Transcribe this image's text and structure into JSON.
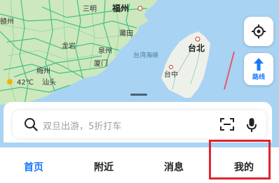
{
  "map": {
    "labels": {
      "ganzhou": "赣州",
      "sanming": "三明",
      "fuzhou": "福州",
      "putian": "莆田",
      "longyan": "龙岩",
      "quanzhou": "泉州",
      "xiamen": "厦门",
      "taiwan_strait": "台湾海峡",
      "taipei": "台北",
      "taichung": "台中",
      "meizhou": "梅州",
      "weather": "42℃",
      "shantou": "汕头"
    },
    "colors": {
      "sea": "#a9d3f2",
      "land": "#f3f2ee",
      "green_land": "#c9e6b8",
      "road": "#2eb87a"
    }
  },
  "controls": {
    "locate_icon": "crosshair-icon",
    "route_icon": "arrow-up-icon",
    "route_label": "路线"
  },
  "search": {
    "placeholder": "双旦出游，5折打车",
    "search_icon": "search-icon",
    "scan_icon": "scan-icon",
    "mic_icon": "microphone-icon"
  },
  "tabs": [
    {
      "label": "首页",
      "active": true
    },
    {
      "label": "附近",
      "active": false
    },
    {
      "label": "消息",
      "active": false
    },
    {
      "label": "我的",
      "active": false
    }
  ],
  "accent": "#1677ff",
  "highlight_color": "#e0262f"
}
